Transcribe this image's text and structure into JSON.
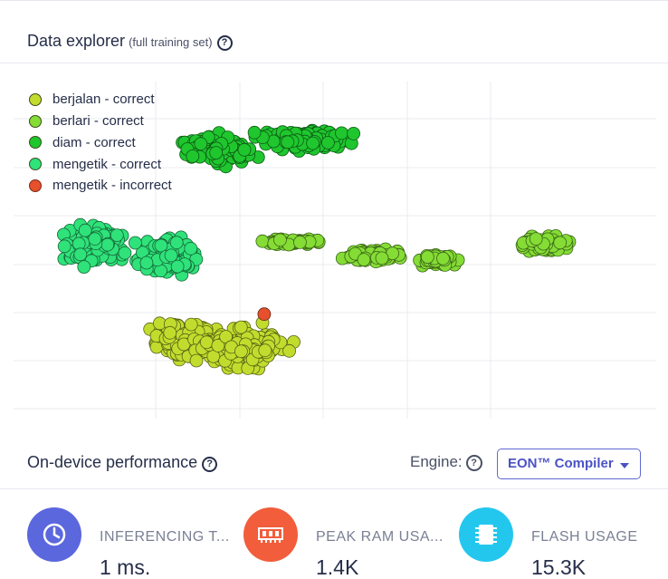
{
  "data_explorer": {
    "title": "Data explorer",
    "subtitle": "(full training set)",
    "help_icon": "question-circle-icon"
  },
  "legend": [
    {
      "label": "berjalan - correct",
      "color": "#c2dc2e"
    },
    {
      "label": "berlari - correct",
      "color": "#84dc35"
    },
    {
      "label": "diam - correct",
      "color": "#1fc62e"
    },
    {
      "label": "mengetik - correct",
      "color": "#2fe27a"
    },
    {
      "label": "mengetik - incorrect",
      "color": "#e6502c"
    }
  ],
  "performance": {
    "title": "On-device performance",
    "engine_label": "Engine:",
    "engine_value": "EON™ Compiler",
    "stats": [
      {
        "label": "INFERENCING T...",
        "value": "1 ms.",
        "icon": "clock-icon",
        "color": "#5b67dd"
      },
      {
        "label": "PEAK RAM USA...",
        "value": "1.4K",
        "icon": "ram-chip-icon",
        "color": "#f25d3b"
      },
      {
        "label": "FLASH USAGE",
        "value": "15.3K",
        "icon": "flash-chip-icon",
        "color": "#23c7ee"
      }
    ]
  },
  "chart_data": {
    "type": "scatter",
    "title": "",
    "xlabel": "",
    "ylabel": "",
    "grid": true,
    "legend_position": "top-left",
    "series": [
      {
        "name": "berjalan - correct",
        "color": "#c2dc2e",
        "clusters": [
          {
            "cx": 26.5,
            "cy": 23.5,
            "rx": 7,
            "ry": 7,
            "n": 150
          },
          {
            "cx": 35.5,
            "cy": 21,
            "rx": 10,
            "ry": 9,
            "n": 200
          }
        ]
      },
      {
        "name": "berlari - correct",
        "color": "#84dc35",
        "clusters": [
          {
            "cx": 43.5,
            "cy": 52.5,
            "rx": 6,
            "ry": 1.5,
            "n": 60
          },
          {
            "cx": 56,
            "cy": 48.5,
            "rx": 7,
            "ry": 3,
            "n": 80
          },
          {
            "cx": 66,
            "cy": 47,
            "rx": 5,
            "ry": 3,
            "n": 60
          },
          {
            "cx": 82.5,
            "cy": 52,
            "rx": 6,
            "ry": 4,
            "n": 60
          }
        ]
      },
      {
        "name": "diam - correct",
        "color": "#1fc62e",
        "clusters": [
          {
            "cx": 32,
            "cy": 79.5,
            "rx": 8,
            "ry": 7,
            "n": 120
          },
          {
            "cx": 45,
            "cy": 83,
            "rx": 12,
            "ry": 4.5,
            "n": 140
          }
        ]
      },
      {
        "name": "mengetik - correct",
        "color": "#2fe27a",
        "clusters": [
          {
            "cx": 12.5,
            "cy": 51.5,
            "rx": 7,
            "ry": 9,
            "n": 150
          },
          {
            "cx": 24,
            "cy": 48,
            "rx": 8,
            "ry": 8,
            "n": 150
          }
        ]
      },
      {
        "name": "mengetik - incorrect",
        "color": "#e6502c",
        "points": [
          [
            39,
            31
          ]
        ]
      }
    ],
    "xlim": [
      0,
      100
    ],
    "ylim": [
      0,
      100
    ]
  }
}
